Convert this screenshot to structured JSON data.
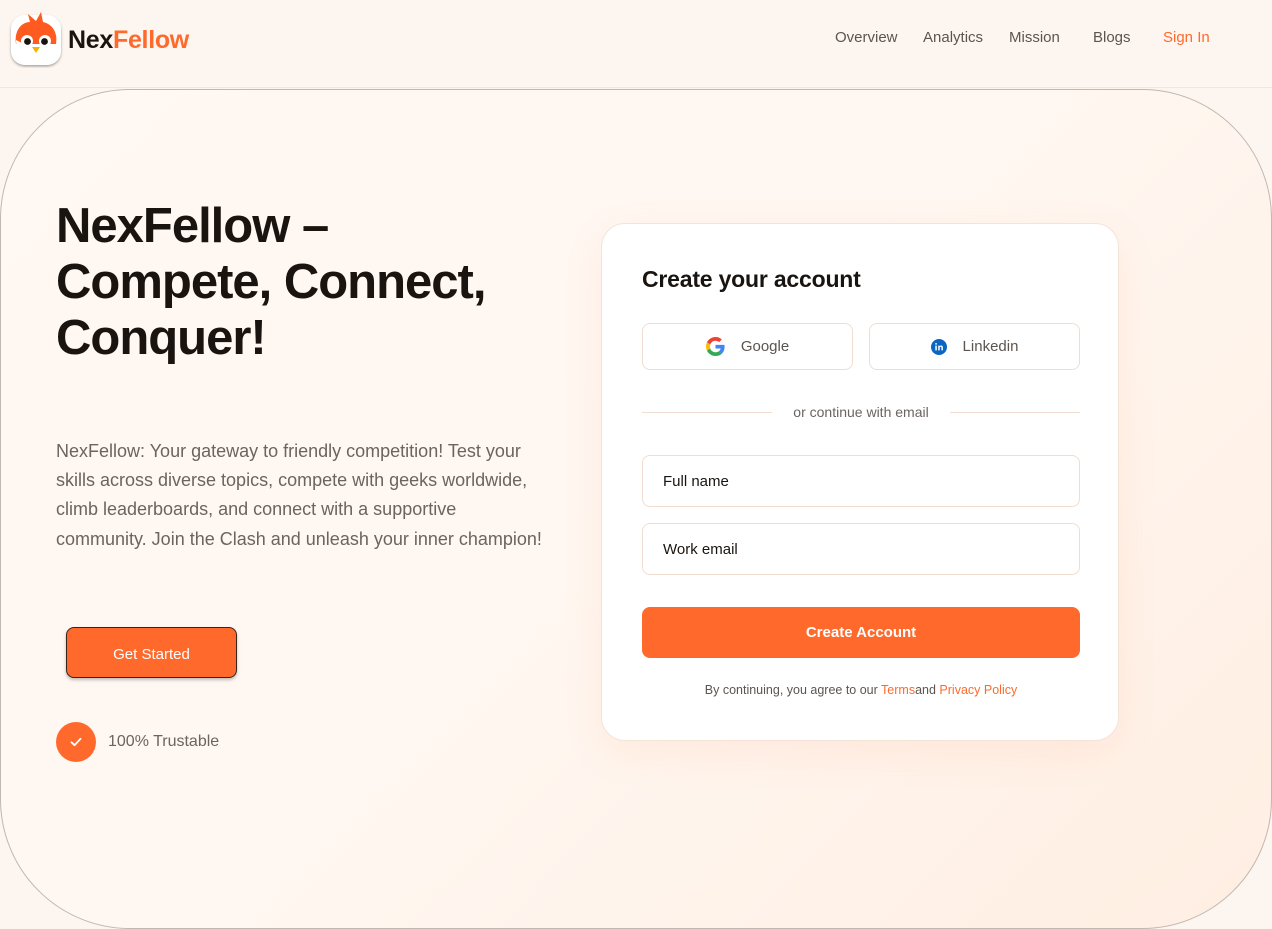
{
  "brand": {
    "name_part1": "Nex",
    "name_part2": "Fellow",
    "logo_icon": "bird-mascot-icon",
    "accent_color": "#ff6a2c"
  },
  "nav": {
    "items": [
      {
        "label": "Overview"
      },
      {
        "label": "Analytics"
      },
      {
        "label": "Mission"
      },
      {
        "label": "Blogs"
      }
    ],
    "sign_in": "Sign In"
  },
  "hero": {
    "title": "NexFellow – Compete, Connect, Conquer!",
    "description": "NexFellow: Your gateway to friendly competition! Test your skills across diverse topics, compete with geeks worldwide, climb leaderboards, and connect with a supportive community. Join the Clash and unleash your inner champion!",
    "cta_label": "Get Started",
    "trust_label": "100% Trustable",
    "trust_icon": "check-icon"
  },
  "signup": {
    "title": "Create your account",
    "google_label": "Google",
    "google_icon": "google-icon",
    "linkedin_label": "Linkedin",
    "linkedin_icon": "linkedin-icon",
    "divider_text": "or continue with email",
    "full_name_placeholder": "Full name",
    "email_placeholder": "Work email",
    "submit_label": "Create Account",
    "legal_prefix": "By continuing, you agree to our ",
    "terms_label": "Terms",
    "legal_and": "and ",
    "privacy_label": "Privacy Policy"
  }
}
